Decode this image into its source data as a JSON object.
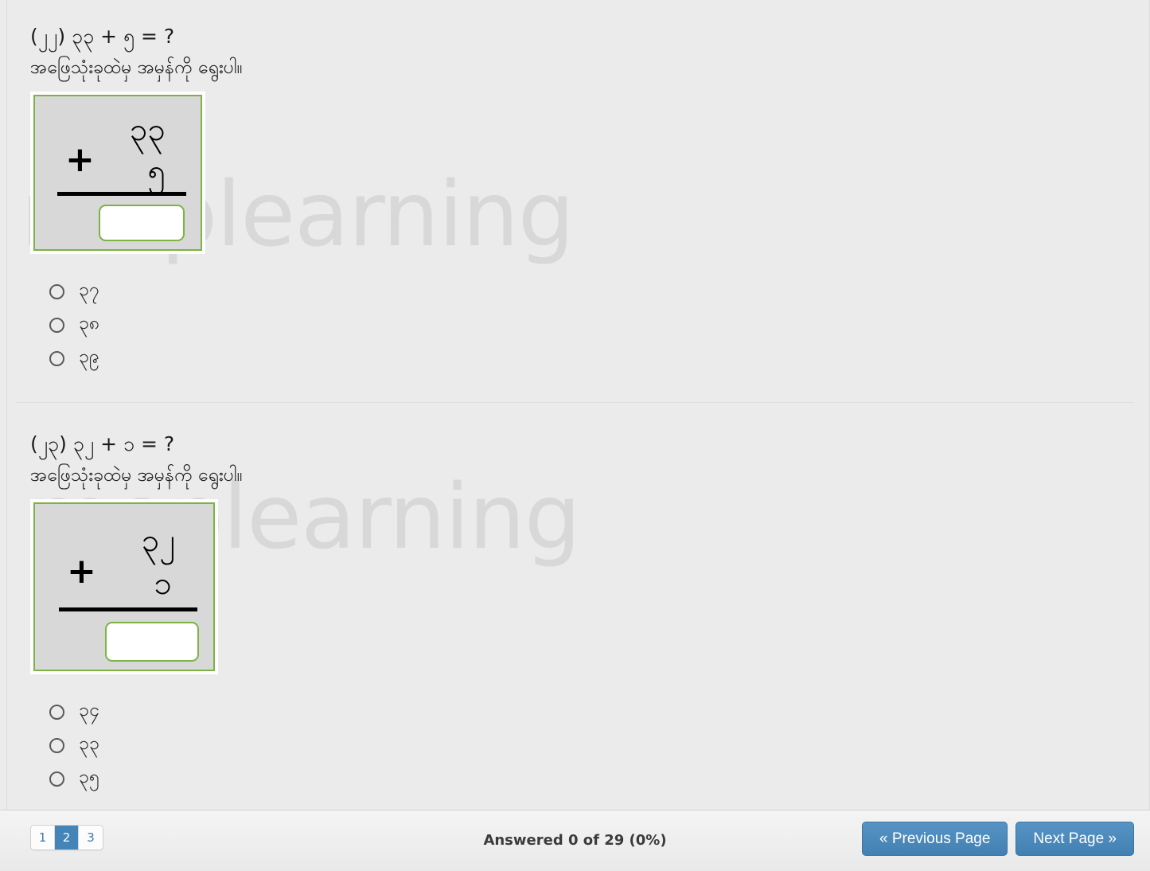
{
  "watermark": {
    "text": "meplearning"
  },
  "questions": [
    {
      "number_label": "(၂၂) ၃၃ + ၅ = ?",
      "instruction": "အဖြေသုံးခုထဲမှ အမှန်ကို ရွေးပါ။",
      "sum": {
        "plus": "+",
        "top": "၃၃",
        "bottom": "၅",
        "answer_value": ""
      },
      "options": [
        {
          "label": "၃၇",
          "selected": false
        },
        {
          "label": "၃၈",
          "selected": false
        },
        {
          "label": "၃၉",
          "selected": false
        }
      ]
    },
    {
      "number_label": "(၂၃) ၃၂ + ၁ = ?",
      "instruction": "အဖြေသုံးခုထဲမှ အမှန်ကို ရွေးပါ။",
      "sum": {
        "plus": "+",
        "top": "၃၂",
        "bottom": "၁",
        "answer_value": ""
      },
      "options": [
        {
          "label": "၃၄",
          "selected": false
        },
        {
          "label": "၃၃",
          "selected": false
        },
        {
          "label": "၃၅",
          "selected": false
        }
      ]
    }
  ],
  "footer": {
    "pagination": [
      {
        "label": "1",
        "active": false
      },
      {
        "label": "2",
        "active": true
      },
      {
        "label": "3",
        "active": false
      }
    ],
    "status_text": "Answered 0 of 29 (0%)",
    "previous_label": "« Previous Page",
    "next_label": "Next Page »"
  },
  "colors": {
    "page_background": "#ebebeb",
    "watermark": "#d8d8d8",
    "box_border_green": "#7cb342",
    "box_fill_gray": "#d8d8d8",
    "button_blue": "#4584b6",
    "pagination_link": "#3b79ac",
    "text_primary": "#1b1b1b"
  }
}
